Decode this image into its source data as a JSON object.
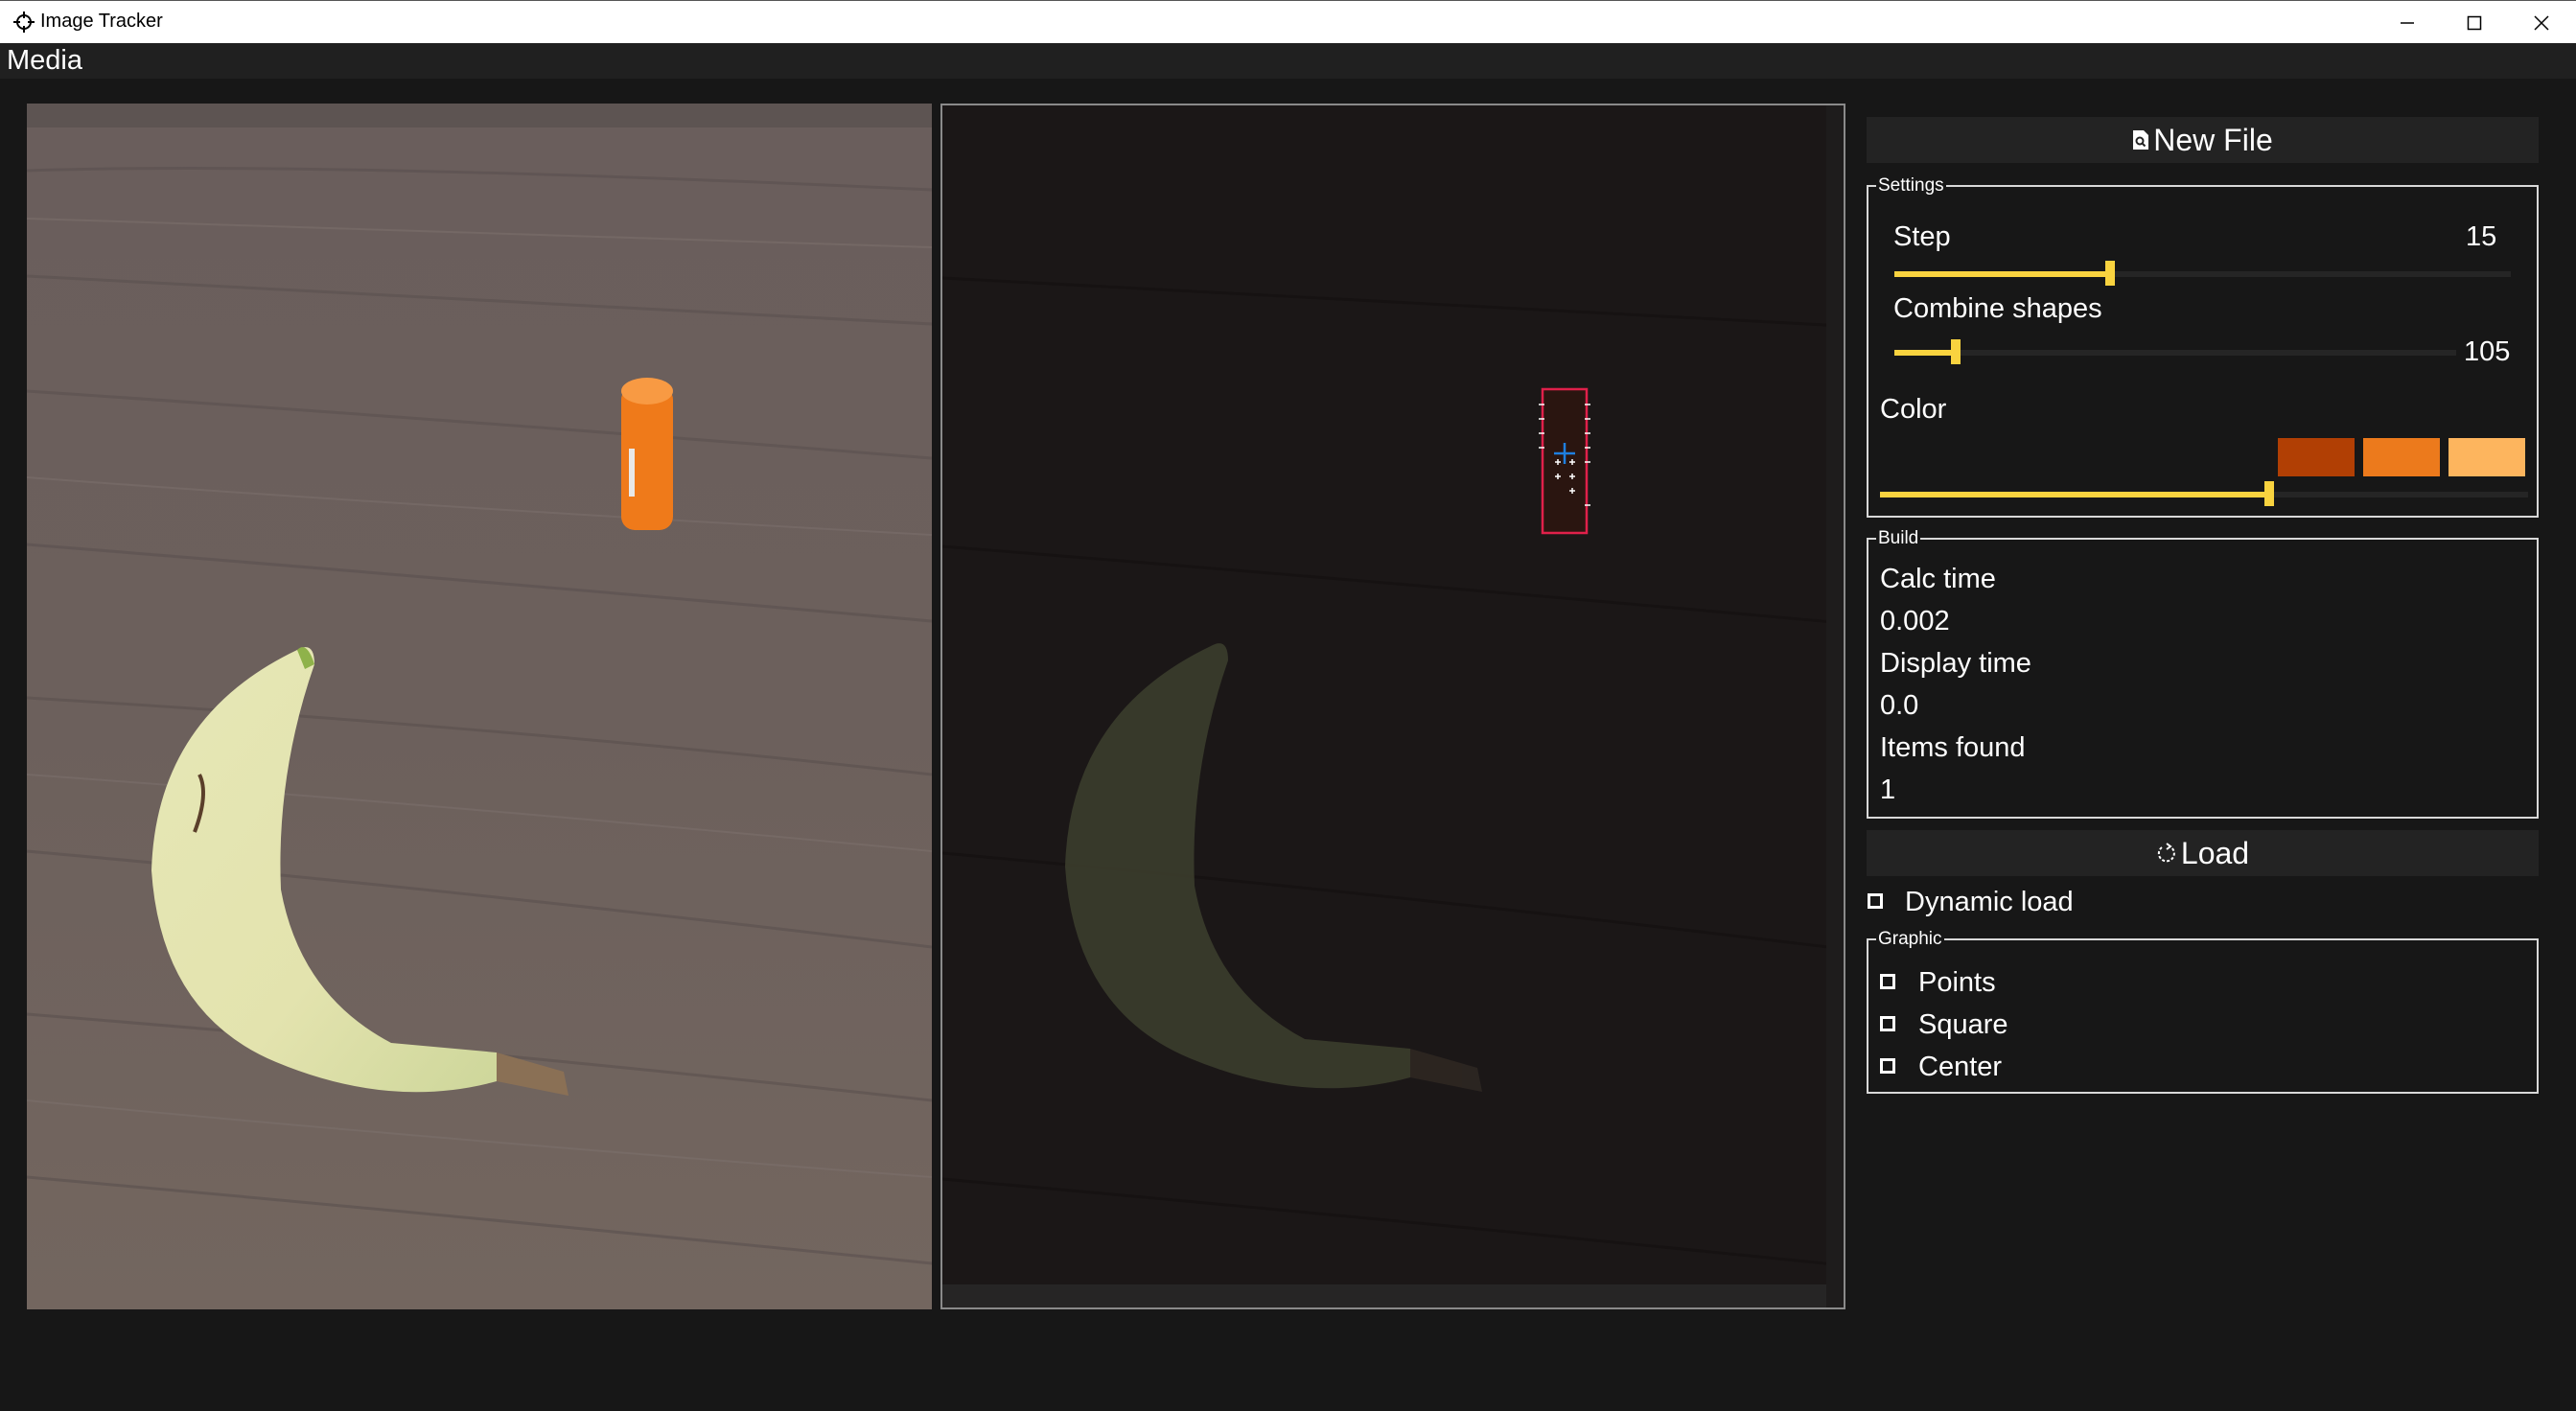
{
  "window": {
    "title": "Image Tracker",
    "app_icon": "crosshair-icon",
    "controls": [
      "minimize-icon",
      "maximize-icon",
      "close-icon"
    ]
  },
  "menu": {
    "items": [
      {
        "label": "Media"
      }
    ]
  },
  "images": {
    "source": {
      "label": "source-image",
      "content": "banana and orange lip balm on wooden table"
    },
    "processed": {
      "label": "processed-image",
      "content": "darkened image with detected orange object highlighted",
      "detection": {
        "box_color": "#e0204a",
        "center_color": "#1e7fe0"
      }
    }
  },
  "sidebar": {
    "new_file_button": {
      "label": "New File",
      "icon": "file-search-icon"
    },
    "settings": {
      "legend": "Settings",
      "step": {
        "label": "Step",
        "value": "15",
        "fraction": 0.35
      },
      "combine_shapes": {
        "label": "Combine shapes",
        "value": "105",
        "fraction": 0.11
      },
      "color": {
        "label": "Color",
        "fraction": 0.6,
        "swatches": [
          "#b13f04",
          "#ec7a1c",
          "#fdb55e"
        ]
      }
    },
    "build": {
      "legend": "Build",
      "calc_time_label": "Calc time",
      "calc_time_value": "0.002",
      "display_time_label": "Display time",
      "display_time_value": "0.0",
      "items_found_label": "Items found",
      "items_found_value": "1"
    },
    "load_button": {
      "label": "Load",
      "icon": "reload-icon"
    },
    "dynamic_load": {
      "label": "Dynamic load",
      "checked": false
    },
    "graphic": {
      "legend": "Graphic",
      "options": [
        {
          "label": "Points",
          "checked": false
        },
        {
          "label": "Square",
          "checked": false
        },
        {
          "label": "Center",
          "checked": false
        }
      ]
    }
  },
  "colors": {
    "accent": "#f9d33f",
    "background": "#171717",
    "button": "#232323"
  }
}
